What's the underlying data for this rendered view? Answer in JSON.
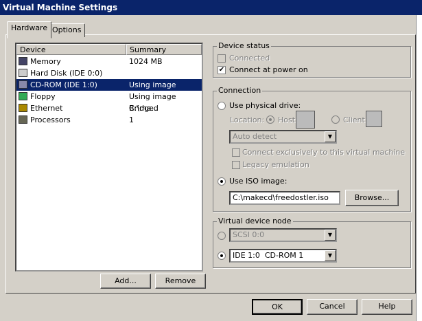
{
  "window": {
    "title": "Virtual Machine Settings"
  },
  "tabs": [
    {
      "label": "Hardware",
      "active": true
    },
    {
      "label": "Options",
      "active": false
    }
  ],
  "device_list": {
    "columns": [
      "Device",
      "Summary"
    ],
    "rows": [
      {
        "device": "Memory",
        "summary": "1024 MB",
        "icon": "memory-icon"
      },
      {
        "device": "Hard Disk (IDE 0:0)",
        "summary": "",
        "icon": "hard-disk-icon"
      },
      {
        "device": "CD-ROM (IDE 1:0)",
        "summary": "Using image C:\\ma...",
        "icon": "cdrom-icon",
        "selected": true
      },
      {
        "device": "Floppy",
        "summary": "Using image C:\\ma...",
        "icon": "floppy-icon"
      },
      {
        "device": "Ethernet",
        "summary": "Bridged",
        "icon": "ethernet-icon"
      },
      {
        "device": "Processors",
        "summary": "1",
        "icon": "processor-icon"
      }
    ]
  },
  "list_buttons": {
    "add": "Add...",
    "remove": "Remove"
  },
  "device_status": {
    "legend": "Device status",
    "connected": "Connected",
    "connected_checked": false,
    "power_on": "Connect at power on",
    "power_on_checked": true
  },
  "connection": {
    "legend": "Connection",
    "physical": "Use physical drive:",
    "location": "Location:",
    "host": "Host",
    "client": "Client",
    "drive_select": "Auto detect",
    "exclusive": "Connect exclusively to this virtual machine",
    "legacy": "Legacy emulation",
    "iso": "Use ISO image:",
    "iso_path": "C:\\makecd\\freedostler.iso",
    "browse": "Browse..."
  },
  "node": {
    "legend": "Virtual device node",
    "scsi": "SCSI 0:0",
    "ide": "IDE 1:0  CD-ROM 1"
  },
  "footer": {
    "ok": "OK",
    "cancel": "Cancel",
    "help": "Help"
  },
  "colors": {
    "titlebar": "#0a246a",
    "selection": "#0a246a",
    "face": "#d4d0c8"
  }
}
